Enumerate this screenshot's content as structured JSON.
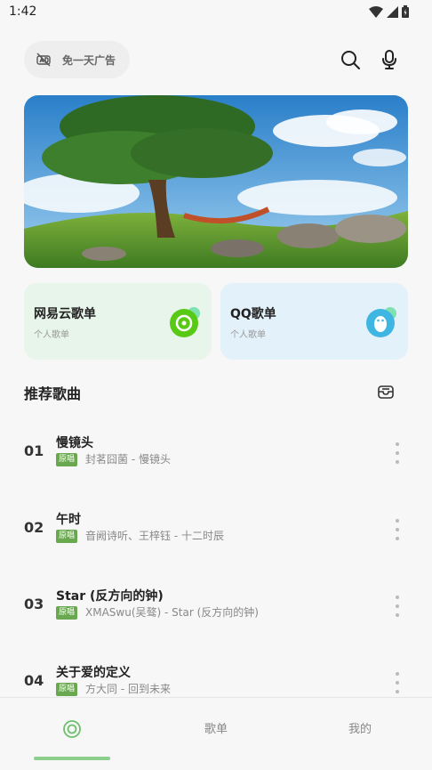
{
  "status": {
    "time": "1:42"
  },
  "topbar": {
    "ad_label": "免一天广告"
  },
  "cards": [
    {
      "title": "网易云歌单",
      "subtitle": "个人歌单",
      "bg": "#e8f5ea",
      "accent": "#58c914",
      "icon": "netease-music-icon"
    },
    {
      "title": "QQ歌单",
      "subtitle": "个人歌单",
      "bg": "#e3f1fb",
      "accent": "#3fb6e2",
      "icon": "qq-penguin-icon"
    }
  ],
  "section": {
    "title": "推荐歌曲"
  },
  "songs": [
    {
      "num": "01",
      "title": "慢镜头",
      "tag": "原唱",
      "sub": "封茗囧菌 - 慢镜头"
    },
    {
      "num": "02",
      "title": "午时",
      "tag": "原唱",
      "sub": "音阙诗听、王梓钰 - 十二时辰"
    },
    {
      "num": "03",
      "title": "Star (反方向的钟)",
      "tag": "原唱",
      "sub": "XMASwu(吴骜) - Star (反方向的钟)"
    },
    {
      "num": "04",
      "title": "关于爱的定义",
      "tag": "原唱",
      "sub": "方大同 - 回到未来"
    }
  ],
  "nav": {
    "items": [
      {
        "label": ""
      },
      {
        "label": "歌单"
      },
      {
        "label": "我的"
      }
    ],
    "active_color": "#6cc06c"
  }
}
